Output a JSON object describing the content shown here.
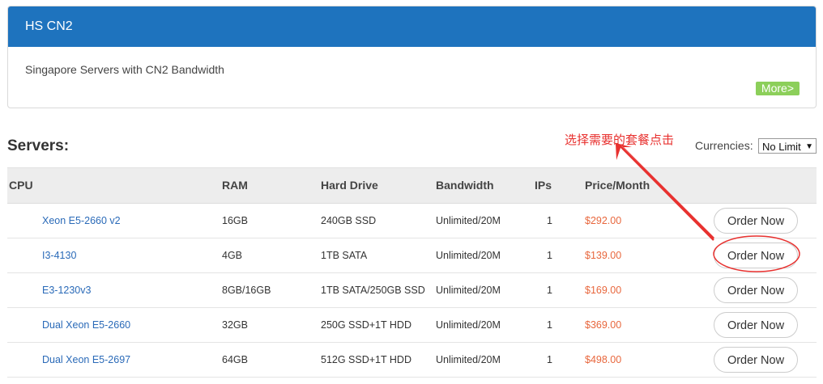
{
  "panel": {
    "title": "HS CN2",
    "description": "Singapore Servers with CN2 Bandwidth",
    "more_label": "More>"
  },
  "servers_title": "Servers:",
  "annotation": "选择需要的套餐点击",
  "currency": {
    "label": "Currencies:",
    "selected": "No Limit",
    "caret": "▼"
  },
  "table": {
    "headers": [
      "CPU",
      "RAM",
      "Hard Drive",
      "Bandwidth",
      "IPs",
      "Price/Month"
    ],
    "rows": [
      {
        "cpu": "Xeon E5-2660 v2",
        "ram": "16GB",
        "disk": "240GB SSD",
        "bandwidth": "Unlimited/20M",
        "ips": "1",
        "price": "$292.00",
        "action": "Order Now"
      },
      {
        "cpu": "I3-4130",
        "ram": "4GB",
        "disk": "1TB SATA",
        "bandwidth": "Unlimited/20M",
        "ips": "1",
        "price": "$139.00",
        "action": "Order Now"
      },
      {
        "cpu": "E3-1230v3",
        "ram": "8GB/16GB",
        "disk": "1TB SATA/250GB SSD",
        "bandwidth": "Unlimited/20M",
        "ips": "1",
        "price": "$169.00",
        "action": "Order Now"
      },
      {
        "cpu": "Dual Xeon E5-2660",
        "ram": "32GB",
        "disk": "250G SSD+1T HDD",
        "bandwidth": "Unlimited/20M",
        "ips": "1",
        "price": "$369.00",
        "action": "Order Now"
      },
      {
        "cpu": "Dual Xeon E5-2697",
        "ram": "64GB",
        "disk": "512G SSD+1T HDD",
        "bandwidth": "Unlimited/20M",
        "ips": "1",
        "price": "$498.00",
        "action": "Order Now"
      }
    ]
  },
  "colors": {
    "header_blue": "#1e73be",
    "more_green": "#8ccf5a",
    "price_orange": "#e8673d",
    "annotation_red": "#e8312f",
    "cpu_link": "#2a6ab8"
  }
}
